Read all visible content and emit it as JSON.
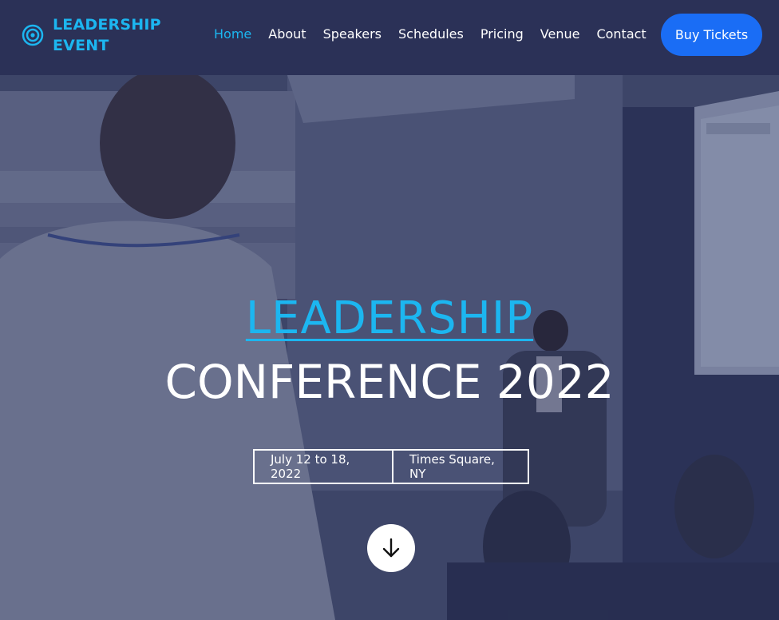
{
  "brand": {
    "line1": "LEADERSHIP",
    "line2": "EVENT",
    "icon": "target-icon"
  },
  "nav": {
    "items": [
      {
        "label": "Home",
        "active": true
      },
      {
        "label": "About",
        "active": false
      },
      {
        "label": "Speakers",
        "active": false
      },
      {
        "label": "Schedules",
        "active": false
      },
      {
        "label": "Pricing",
        "active": false
      },
      {
        "label": "Venue",
        "active": false
      },
      {
        "label": "Contact",
        "active": false
      }
    ],
    "cta_label": "Buy Tickets"
  },
  "hero": {
    "title_highlight": "LEADERSHIP",
    "title_main": "CONFERENCE 2022",
    "date": "July 12 to 18, 2022",
    "location": "Times Square, NY",
    "scroll_icon": "arrow-down-icon"
  },
  "colors": {
    "accent": "#1cb6f0",
    "cta": "#1a6df5",
    "navbar_bg": "#2b3157"
  }
}
